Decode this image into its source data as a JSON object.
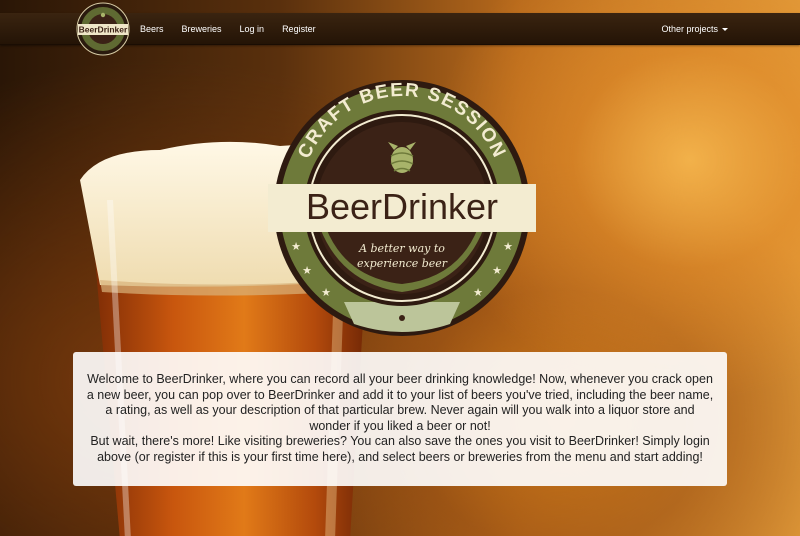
{
  "nav": {
    "brand_logo_text": "BeerDrinker",
    "links": [
      "Beers",
      "Breweries",
      "Log in",
      "Register"
    ],
    "right_menu": "Other projects"
  },
  "badge": {
    "arc_text": "CRAFT BEER SESSION",
    "title": "BeerDrinker",
    "tagline_line1": "A better way to",
    "tagline_line2": "experience beer",
    "icons": [
      "hop-icon",
      "star-icon"
    ]
  },
  "welcome": {
    "paragraph1": "Welcome to BeerDrinker, where you can record all your beer drinking knowledge! Now, whenever you crack open a new beer, you can pop over to BeerDrinker and add it to your list of beers you've tried, including the beer name, a rating, as well as your description of that particular brew. Never again will you walk into a liquor store and wonder if you liked a beer or not!",
    "paragraph2": "But wait, there's more! Like visiting breweries? You can also save the ones you visit to BeerDrinker! Simply login above (or register if this is your first time here), and select beers or breweries from the menu and start adding!"
  },
  "colors": {
    "badge_dark": "#3b2216",
    "badge_olive": "#6e7a3a",
    "badge_cream": "#f3ecd1",
    "badge_sage": "#bcc59a"
  }
}
